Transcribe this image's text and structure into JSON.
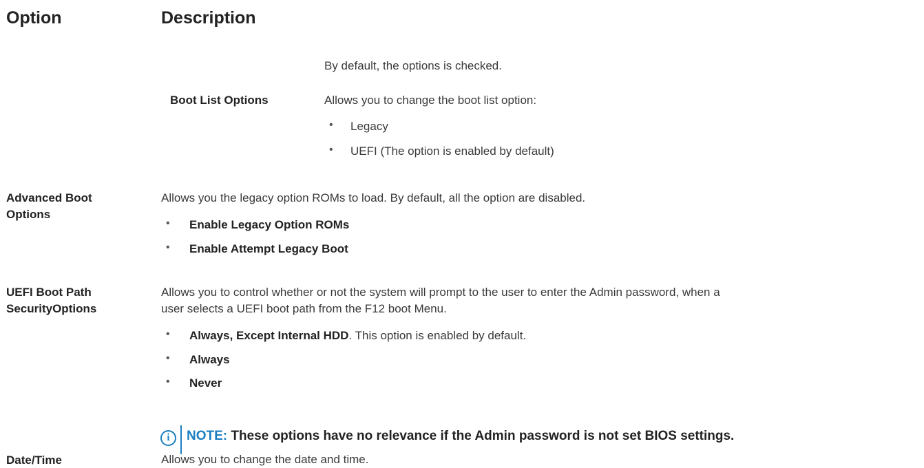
{
  "header": {
    "option": "Option",
    "description": "Description"
  },
  "rows": {
    "boot_sequence_default": "By default, the options is checked.",
    "boot_list": {
      "label": "Boot List Options",
      "desc": "Allows you to change the boot list option:",
      "items": [
        "Legacy",
        "UEFI (The option is enabled by default)"
      ]
    },
    "advanced_boot": {
      "label1": "Advanced Boot",
      "label2": "Options",
      "desc": "Allows you the legacy option ROMs to load. By default, all the option are disabled.",
      "items": [
        "Enable Legacy Option ROMs",
        "Enable Attempt Legacy Boot"
      ]
    },
    "uefi_boot_path": {
      "label1": "UEFI Boot Path",
      "label2": "SecurityOptions",
      "desc1": "Allows you to control whether or not the system will prompt to the user to enter the Admin password, when a",
      "desc2": "user selects a UEFI boot path from the F12 boot Menu.",
      "item1_bold": "Always, Except Internal HDD",
      "item1_rest": ". This option is enabled by default.",
      "item2": "Always",
      "item3": "Never"
    },
    "note": {
      "icon": "info-icon",
      "label": "NOTE:",
      "text": " These options have no relevance if the Admin password is not set BIOS settings."
    },
    "date_time": {
      "label": "Date/Time",
      "desc": "Allows you to change the date and time."
    }
  },
  "bullet": "•",
  "colors": {
    "accent": "#1a7fc1"
  }
}
